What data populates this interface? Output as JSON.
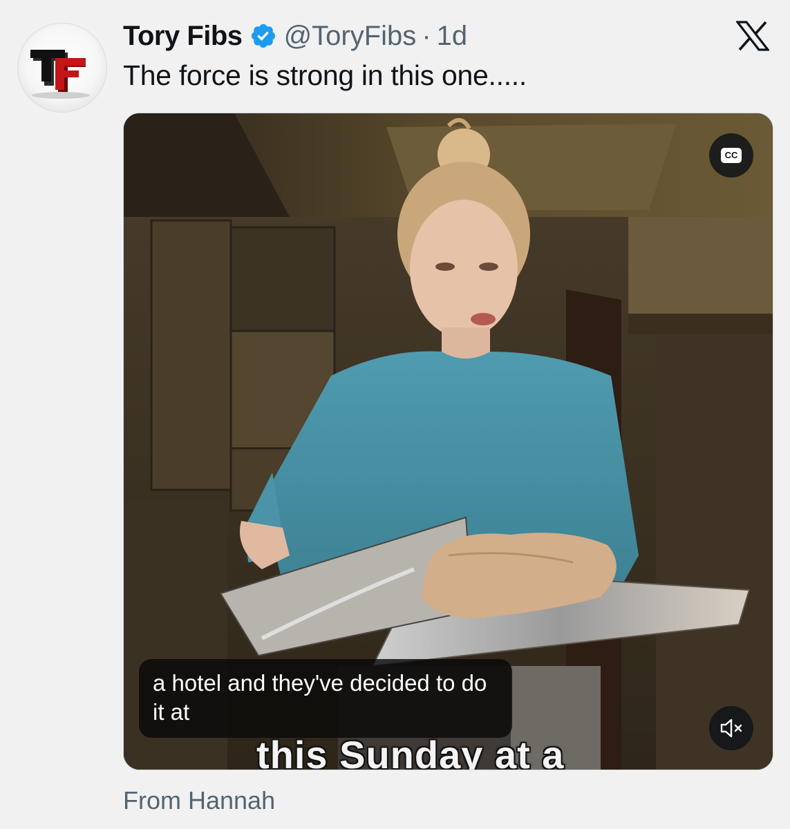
{
  "author": {
    "name": "Tory Fibs",
    "handle": "@ToryFibs",
    "separator": "·",
    "time": "1d",
    "avatar_letters": "TF",
    "verified_color": "#1d9bf0"
  },
  "tweet": {
    "text": "The force is strong in this one....."
  },
  "media": {
    "type": "video",
    "cc_label": "CC",
    "caption": "a hotel and they've decided to do it at",
    "burned_in_text": "this Sunday at a",
    "mute_icon": "speaker-muted-icon"
  },
  "footer": {
    "text": "From Hannah"
  },
  "platform": {
    "logo": "x-logo-icon"
  }
}
